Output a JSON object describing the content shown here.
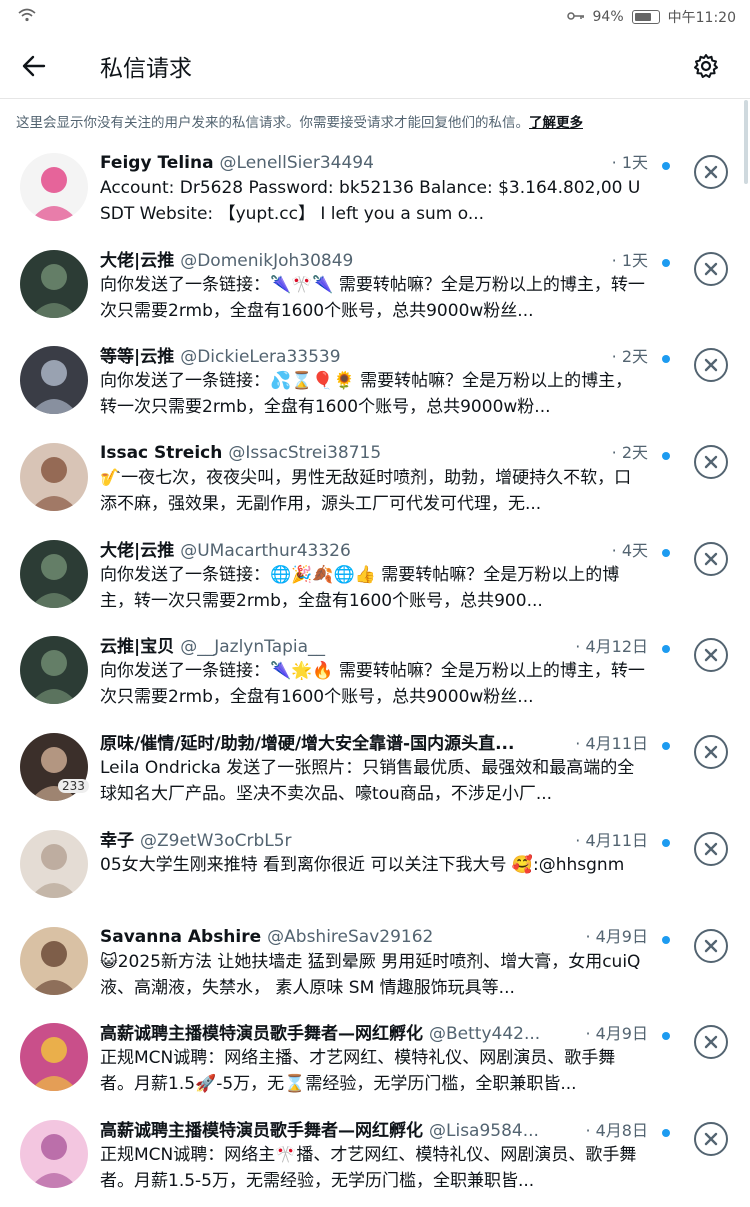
{
  "status_bar": {
    "battery": "94%",
    "time": "中午11:20"
  },
  "header": {
    "title": "私信请求"
  },
  "notice": {
    "text": "这里会显示你没有关注的用户发来的私信请求。你需要接受请求才能回复他们的私信。",
    "link": "了解更多"
  },
  "requests": [
    {
      "name": "Feigy Telina",
      "handle": "@LenellSier34494",
      "time": "· 1天",
      "message": "Account: Dr5628 Password: bk52136  Balance: $3.164.802,00 USDT  Website: 【yupt.cc】 I left you a sum o...",
      "avatar_color": "#f4f4f4",
      "accent": "#e34a8a"
    },
    {
      "name": "大佬|云推",
      "handle": "@DomenikJoh30849",
      "time": "· 1天",
      "message": "向你发送了一条链接：🌂🎌🌂 需要转帖嘛？全是万粉以上的博主，转一次只需要2rmb，全盘有1600个账号，总共9000w粉丝...",
      "avatar_color": "#2c3c35",
      "accent": "#6f8a70"
    },
    {
      "name": "等等|云推",
      "handle": "@DickieLera33539",
      "time": "· 2天",
      "message": "向你发送了一条链接：💦⌛🎈🌻 需要转帖嘛？全是万粉以上的博主，转一次只需要2rmb，全盘有1600个账号，总共9000w粉...",
      "avatar_color": "#3a3d46",
      "accent": "#aab4c4"
    },
    {
      "name": "Issac Streich",
      "handle": "@IssacStrei38715",
      "time": "· 2天",
      "message": "🎷一夜七次，夜夜尖叫，男性无敌延时喷剂，助勃，增硬持久不软，口添不麻，强效果，无副作用，源头工厂可代发可代理，无...",
      "avatar_color": "#d8c4b6",
      "accent": "#8a5a44"
    },
    {
      "name": "大佬|云推",
      "handle": "@UMacarthur43326",
      "time": "· 4天",
      "message": "向你发送了一条链接：🌐🎉🍂🌐👍 需要转帖嘛？全是万粉以上的博主，转一次只需要2rmb，全盘有1600个账号，总共900...",
      "avatar_color": "#2c3c35",
      "accent": "#6f8a70"
    },
    {
      "name": "云推|宝贝",
      "handle": "@__JazlynTapia__",
      "time": "· 4月12日",
      "message": "向你发送了一条链接：🌂🌟🔥 需要转帖嘛？全是万粉以上的博主，转一次只需要2rmb，全盘有1600个账号，总共9000w粉丝...",
      "avatar_color": "#2c3c35",
      "accent": "#6f8a70"
    },
    {
      "name": "原味/催情/延时/助勃/增硬/增大安全靠谱-国内源头直...",
      "handle": "",
      "time": "· 4月11日",
      "message": "Leila Ondricka 发送了一张照片：只销售最优质、最强效和最高端的全球知名大厂产品。坚决不卖次品、嚎tou商品，不涉足小厂...",
      "avatar_color": "#3b2f2a",
      "accent": "#c9a890",
      "badge": "233"
    },
    {
      "name": "幸子",
      "handle": "@Z9etW3oCrbL5r",
      "time": "· 4月11日",
      "message": "05女大学生刚来推特 看到离你很近 可以关注下我大号 🥰:@hhsgnm",
      "avatar_color": "#e4dcd4",
      "accent": "#b7a596"
    },
    {
      "name": "Savanna Abshire",
      "handle": "@AbshireSav29162",
      "time": "· 4月9日",
      "message": "😺2025新方法 让她扶墙走 猛到晕厥  男用延时喷剂、增大膏，女用cuiQ液、高潮液，失禁水，  素人原味  SM  情趣服饰玩具等...",
      "avatar_color": "#d9c1a4",
      "accent": "#6d4c3a"
    },
    {
      "name": "高薪诚聘主播模特演员歌手舞者—网红孵化",
      "handle": "@Betty442...",
      "time": "· 4月9日",
      "message": "正规MCN诚聘：网络主播、才艺网红、模特礼仪、网剧演员、歌手舞者。月薪1.5🚀-5万，无⌛需经验，无学历门槛，全职兼职皆...",
      "avatar_color": "#c94f8a",
      "accent": "#f0c040"
    },
    {
      "name": "高薪诚聘主播模特演员歌手舞者—网红孵化",
      "handle": "@Lisa9584...",
      "time": "· 4月8日",
      "message": "正规MCN诚聘：网络主🎌播、才艺网红、模特礼仪、网剧演员、歌手舞者。月薪1.5-5万，无需经验，无学历门槛，全职兼职皆...",
      "avatar_color": "#f3c6e0",
      "accent": "#b05fa0"
    }
  ]
}
